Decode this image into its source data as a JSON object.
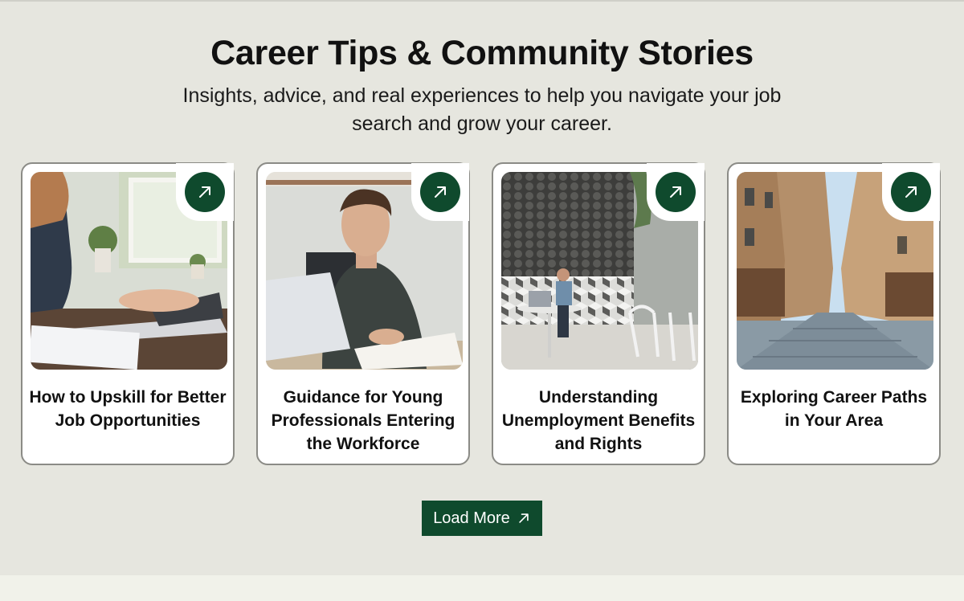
{
  "section": {
    "title": "Career Tips & Community Stories",
    "subtitle": "Insights, advice, and real experiences to help you navigate your job search and grow your career."
  },
  "cards": [
    {
      "title": "How to Upskill for Better Job Opportunities",
      "image": "woman typing on laptop",
      "icon": "arrow-up-right-icon"
    },
    {
      "title": "Guidance for Young Professionals Entering the Workforce",
      "image": "young man at laptop with book",
      "icon": "arrow-up-right-icon"
    },
    {
      "title": "Understanding Unemployment Benefits and Rights",
      "image": "man working in cafe",
      "icon": "arrow-up-right-icon"
    },
    {
      "title": "Exploring Career Paths in Your Area",
      "image": "cobblestone city street",
      "icon": "arrow-up-right-icon"
    }
  ],
  "load_more": {
    "label": "Load More",
    "icon": "arrow-up-right-icon"
  },
  "colors": {
    "accent": "#0f4a2d",
    "background": "#e6e6df",
    "card": "#ffffff",
    "border": "#8b8b86"
  }
}
